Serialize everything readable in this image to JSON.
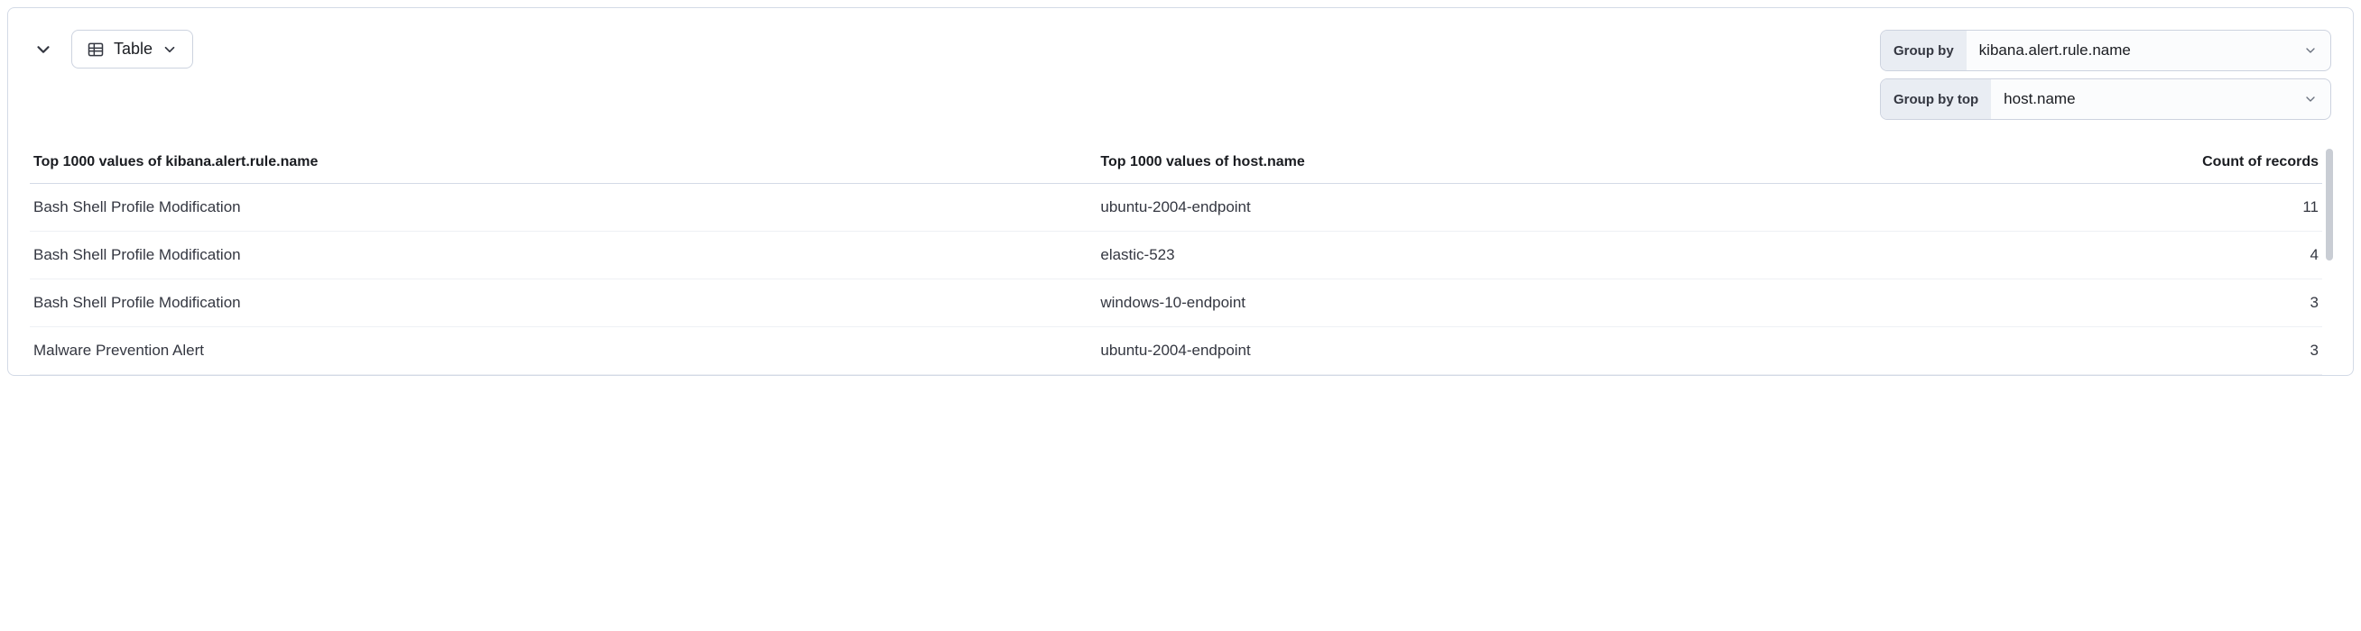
{
  "toolbar": {
    "vis_type_label": "Table"
  },
  "controls": {
    "group_by_label": "Group by",
    "group_by_value": "kibana.alert.rule.name",
    "group_by_top_label": "Group by top",
    "group_by_top_value": "host.name"
  },
  "table": {
    "columns": [
      "Top 1000 values of kibana.alert.rule.name",
      "Top 1000 values of host.name",
      "Count of records"
    ],
    "rows": [
      {
        "rule": "Bash Shell Profile Modification",
        "host": "ubuntu-2004-endpoint",
        "count": "11"
      },
      {
        "rule": "Bash Shell Profile Modification",
        "host": "elastic-523",
        "count": "4"
      },
      {
        "rule": "Bash Shell Profile Modification",
        "host": "windows-10-endpoint",
        "count": "3"
      },
      {
        "rule": "Malware Prevention Alert",
        "host": "ubuntu-2004-endpoint",
        "count": "3"
      }
    ]
  }
}
